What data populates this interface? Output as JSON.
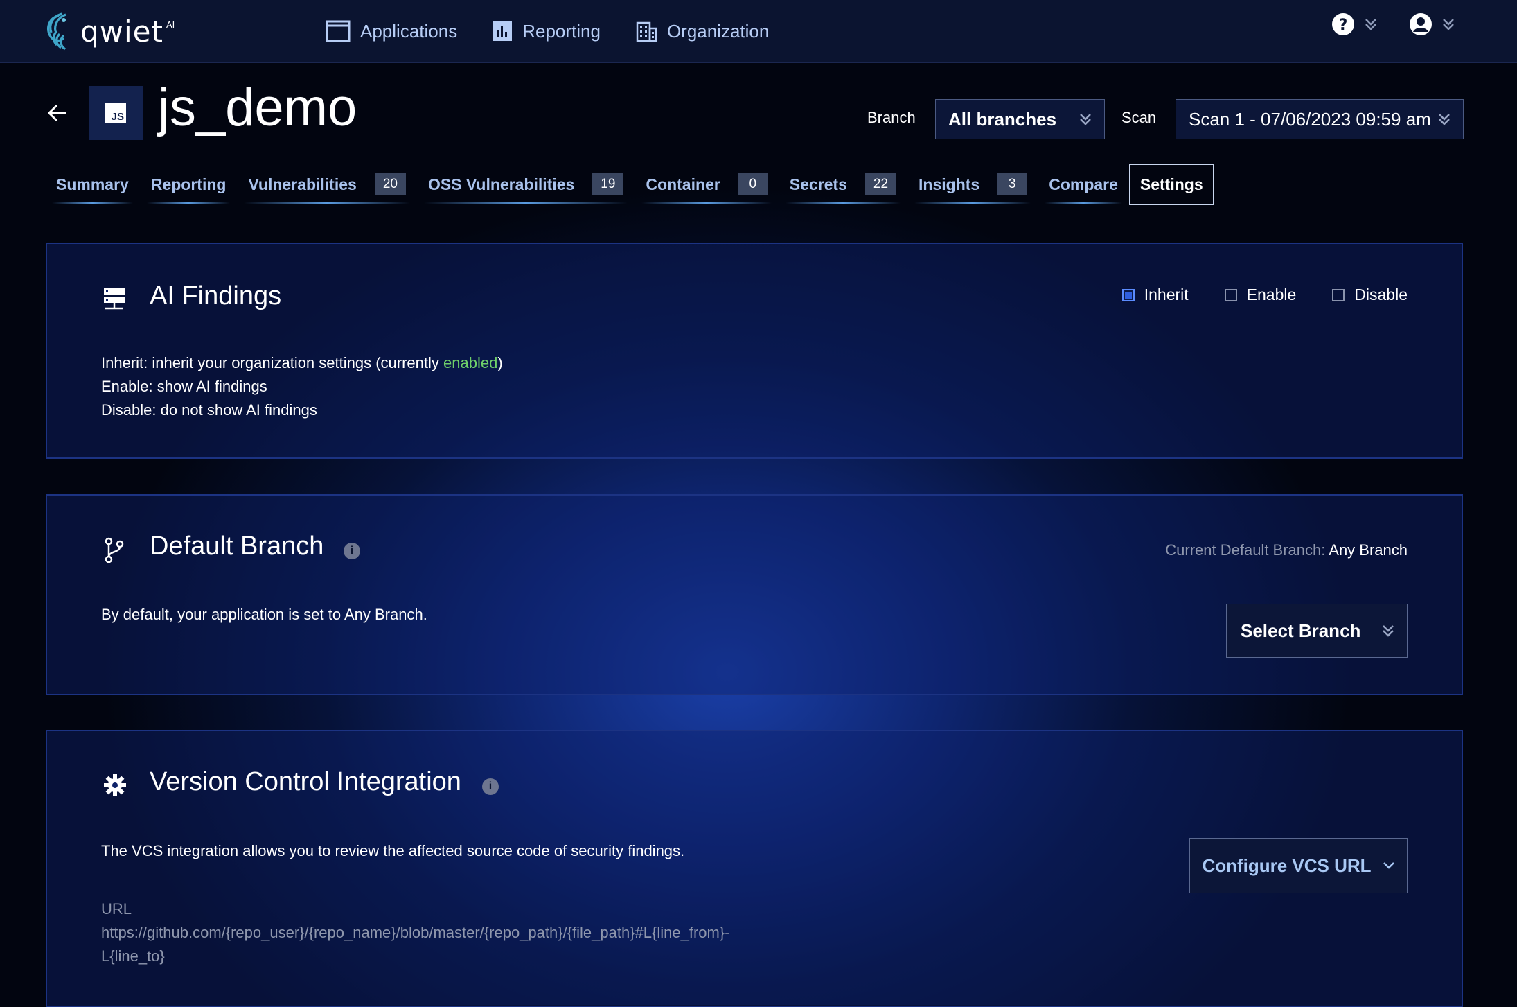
{
  "brand": {
    "name": "qwiet",
    "sup": "AI"
  },
  "nav": {
    "items": [
      {
        "label": "Applications",
        "icon": "window-icon"
      },
      {
        "label": "Reporting",
        "icon": "bar-chart-icon"
      },
      {
        "label": "Organization",
        "icon": "building-icon"
      }
    ]
  },
  "header": {
    "app_icon_text": "JS",
    "title": "js_demo",
    "branch_label": "Branch",
    "branch_value": "All branches",
    "scan_label": "Scan",
    "scan_value": "Scan 1 - 07/06/2023 09:59 am"
  },
  "tabs": [
    {
      "label": "Summary"
    },
    {
      "label": "Reporting"
    },
    {
      "label": "Vulnerabilities",
      "count": "20"
    },
    {
      "label": "OSS Vulnerabilities",
      "count": "19"
    },
    {
      "label": "Container",
      "count": "0"
    },
    {
      "label": "Secrets",
      "count": "22"
    },
    {
      "label": "Insights",
      "count": "3"
    },
    {
      "label": "Compare"
    },
    {
      "label": "Settings",
      "active": true
    }
  ],
  "ai_findings": {
    "title": "AI Findings",
    "options": [
      {
        "label": "Inherit",
        "checked": true
      },
      {
        "label": "Enable",
        "checked": false
      },
      {
        "label": "Disable",
        "checked": false
      }
    ],
    "line1_prefix": "Inherit: inherit your organization settings (currently ",
    "line1_status": "enabled",
    "line1_suffix": ")",
    "line2": "Enable: show AI findings",
    "line3": "Disable: do not show AI findings"
  },
  "default_branch": {
    "title": "Default Branch",
    "current_label": "Current Default Branch:",
    "current_value": "Any Branch",
    "description": "By default, your application is set to Any Branch.",
    "select_button": "Select Branch"
  },
  "vcs": {
    "title": "Version Control Integration",
    "description": "The VCS integration allows you to review the affected source code of security findings.",
    "configure_button": "Configure VCS URL",
    "url_label": "URL",
    "url_line1": "https://github.com/{repo_user}/{repo_name}/blob/master/{repo_path}/{file_path}#L{line_from}-",
    "url_line2": "L{line_to}"
  },
  "colors": {
    "accent_blue": "#a9c2ec",
    "status_green": "#6fd06a",
    "checkbox_blue": "#2f5fe0"
  }
}
